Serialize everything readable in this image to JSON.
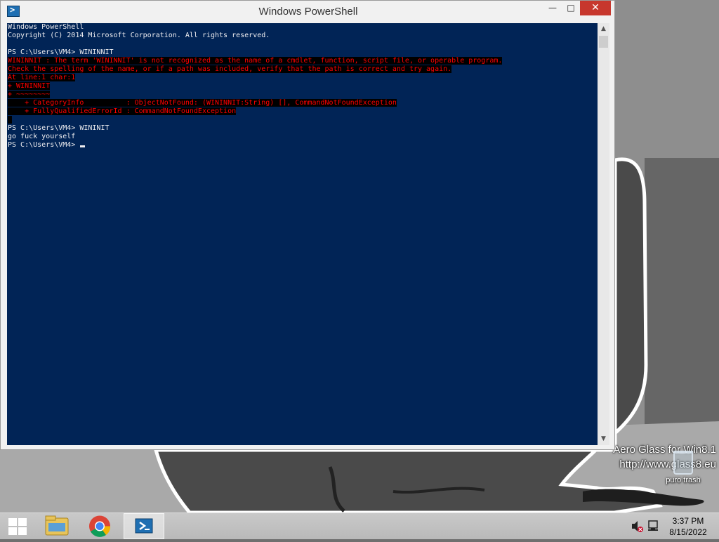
{
  "window": {
    "title": "Windows PowerShell",
    "min_glyph": "—",
    "max_glyph": "□",
    "close_glyph": "✕"
  },
  "console": {
    "lines": [
      {
        "text": "Windows PowerShell",
        "type": "normal"
      },
      {
        "text": "Copyright (C) 2014 Microsoft Corporation. All rights reserved.",
        "type": "normal"
      },
      {
        "text": "",
        "type": "normal"
      },
      {
        "text": "PS C:\\Users\\VM4> WININNIT",
        "type": "normal"
      },
      {
        "text": "WININNIT : The term 'WININNIT' is not recognized as the name of a cmdlet, function, script file, or operable program.",
        "type": "error"
      },
      {
        "text": "Check the spelling of the name, or if a path was included, verify that the path is correct and try again.",
        "type": "error"
      },
      {
        "text": "At line:1 char:1",
        "type": "error"
      },
      {
        "text": "+ WININNIT",
        "type": "error"
      },
      {
        "text": "+ ~~~~~~~~",
        "type": "error"
      },
      {
        "text": "    + CategoryInfo          : ObjectNotFound: (WININNIT:String) [], CommandNotFoundException",
        "type": "error"
      },
      {
        "text": "    + FullyQualifiedErrorId : CommandNotFoundException",
        "type": "error"
      },
      {
        "text": " ",
        "type": "error"
      },
      {
        "text": "PS C:\\Users\\VM4> WININIT",
        "type": "normal"
      },
      {
        "text": "go fuck yourself",
        "type": "normal"
      },
      {
        "text": "PS C:\\Users\\VM4> ",
        "type": "prompt"
      }
    ],
    "colors": {
      "background": "#012456",
      "foreground": "#eeedf0",
      "error_fg": "#ff0000",
      "error_bg": "#000000"
    }
  },
  "desktop": {
    "watermark_line1": "Aero Glass for Win8.1",
    "watermark_line2": "http://www.glass8.eu",
    "recycle_bin_label": "puro trash"
  },
  "taskbar": {
    "pinned": [
      "start-button",
      "file-explorer-icon",
      "chrome-icon",
      "powershell-icon"
    ],
    "clock_time": "3:37 PM",
    "clock_date": "8/15/2022",
    "tray_icons": [
      "volume-muted-icon",
      "network-icon"
    ]
  }
}
